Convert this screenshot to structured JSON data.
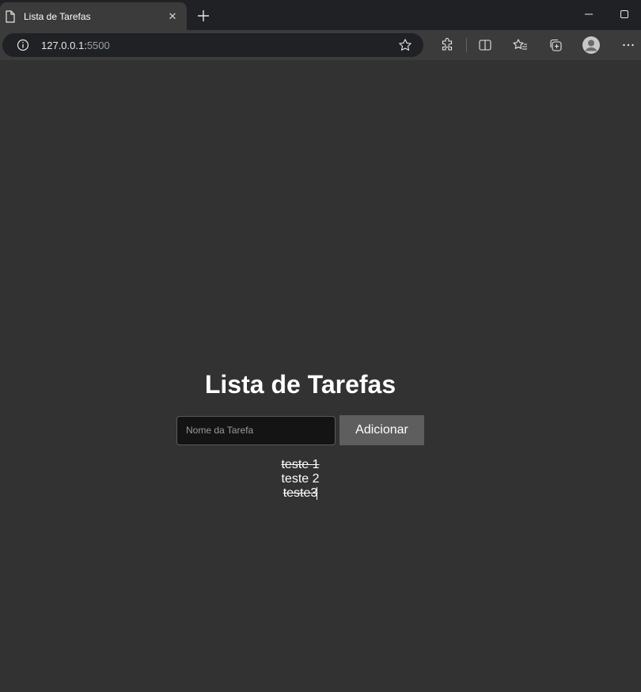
{
  "browser": {
    "tab_title": "Lista de Tarefas",
    "url_host": "127.0.0.1:",
    "url_port": "5500",
    "icons": [
      "document-icon",
      "close-icon",
      "new-tab-icon",
      "minimize-icon",
      "maximize-icon",
      "info-icon",
      "star-icon",
      "extensions-icon",
      "split-screen-icon",
      "favorites-icon",
      "collections-icon",
      "profile-icon",
      "more-icon"
    ]
  },
  "app": {
    "title": "Lista de Tarefas",
    "input_placeholder": "Nome da Tarefa",
    "input_value": "",
    "add_button_label": "Adicionar",
    "tasks": [
      {
        "label": "teste 1",
        "done": true
      },
      {
        "label": "teste 2",
        "done": false
      },
      {
        "label": "teste3",
        "done": true
      }
    ]
  },
  "colors": {
    "page_bg": "#323232",
    "input_bg": "#141414",
    "button_bg": "#5e5e5e",
    "text": "#ffffff"
  }
}
